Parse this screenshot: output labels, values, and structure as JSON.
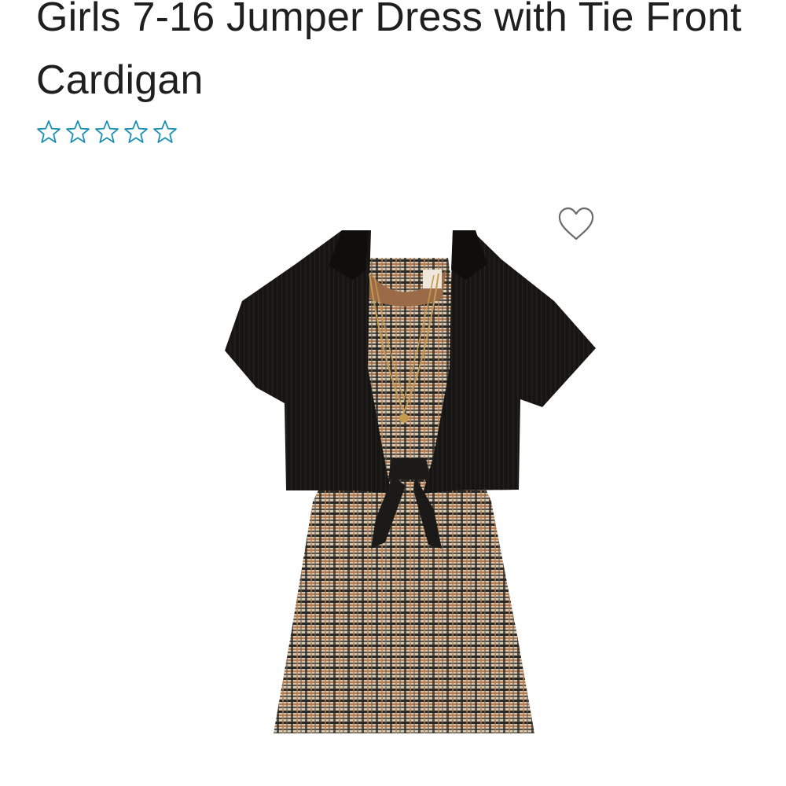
{
  "product": {
    "title": "Girls 7-16 Jumper Dress with Tie Front Cardigan",
    "rating": {
      "stars_filled": 0,
      "stars_total": 5,
      "star_color": "#1a8fb3"
    },
    "favorite_icon": "heart-outline-icon",
    "image_subject": "plaid jumper dress with black tie-front cardigan and gold necklace"
  },
  "colors": {
    "text": "#1f1f1f",
    "star_outline": "#1a8fb3",
    "heart_outline": "#6b6b6b",
    "cardigan": "#151413",
    "plaid_base": "#cdbfa9"
  }
}
